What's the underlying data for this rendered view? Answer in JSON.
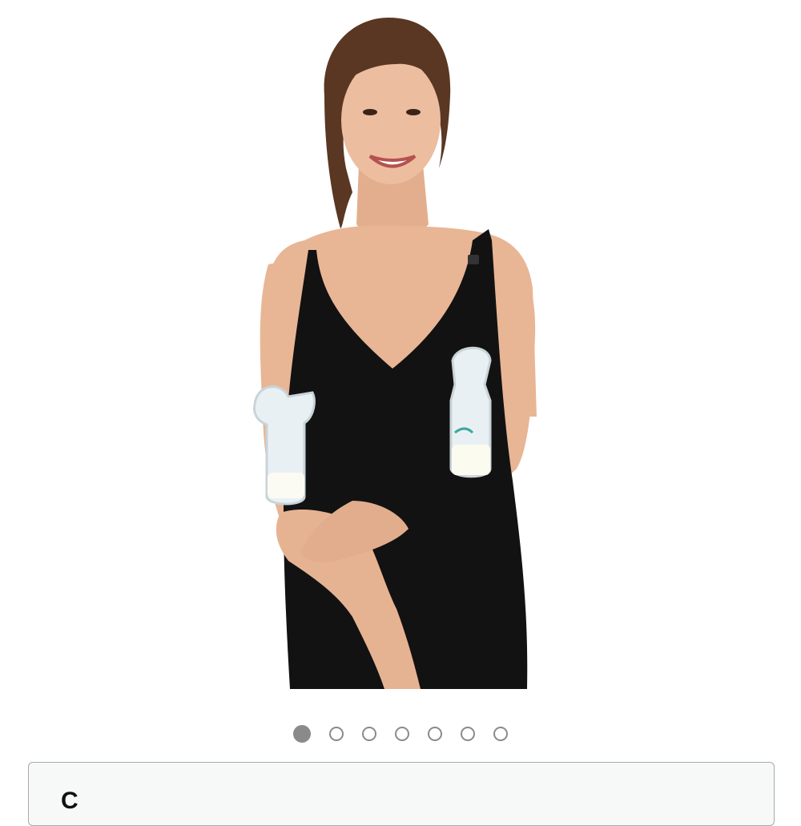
{
  "product_image": {
    "alt_description_icon": "product-photo-nursing-tank-with-pump-bottles"
  },
  "carousel": {
    "total_slides": 7,
    "active_index": 0
  },
  "options_panel": {
    "partial_text": "C"
  },
  "colors": {
    "dot": "#8a8a8a",
    "panel_border": "#a9a9a9",
    "panel_bg": "#f7f8f8",
    "garment": "#121212",
    "skin": "#e9b99a",
    "hair": "#5a3722"
  }
}
